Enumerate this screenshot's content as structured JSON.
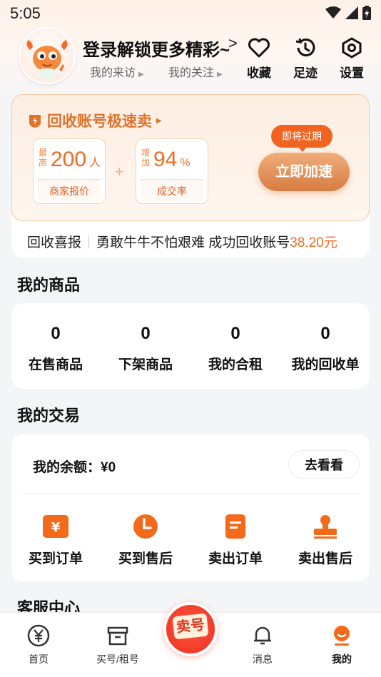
{
  "status_bar": {
    "time": "5:05"
  },
  "header": {
    "login_title": "登录解锁更多精彩~",
    "login_arrow": ">",
    "visitors": "我的来访",
    "following": "我的关注",
    "favorites": "收藏",
    "history": "足迹",
    "settings": "设置"
  },
  "recycle": {
    "title": "回收账号极速卖",
    "stat1": {
      "prefix": "最高",
      "value": "200",
      "unit": "人",
      "label": "商家报价"
    },
    "plus": "+",
    "stat2": {
      "prefix": "增加",
      "value": "94",
      "unit": "%",
      "label": "成交率"
    },
    "expire_badge": "即将过期",
    "speed_button": "立即加速",
    "ticker_label": "回收喜报",
    "ticker_text": "勇敢牛牛不怕艰难 成功回收账号",
    "ticker_amount": "38.20元"
  },
  "goods": {
    "title": "我的商品",
    "items": [
      {
        "count": "0",
        "label": "在售商品"
      },
      {
        "count": "0",
        "label": "下架商品"
      },
      {
        "count": "0",
        "label": "我的合租"
      },
      {
        "count": "0",
        "label": "我的回收单"
      }
    ]
  },
  "trade": {
    "title": "我的交易",
    "balance": "我的余额：¥0",
    "look_button": "去看看",
    "items": [
      {
        "label": "买到订单",
        "icon": "yen-order-icon"
      },
      {
        "label": "买到售后",
        "icon": "clock-icon"
      },
      {
        "label": "卖出订单",
        "icon": "document-icon"
      },
      {
        "label": "卖出售后",
        "icon": "stamp-icon"
      }
    ]
  },
  "service": {
    "title": "客服中心"
  },
  "bottom_nav": {
    "items": [
      {
        "label": "首页",
        "icon": "yen-circle-icon"
      },
      {
        "label": "买号/租号",
        "icon": "box-icon"
      },
      {
        "label": "卖号",
        "icon": "sell-icon"
      },
      {
        "label": "消息",
        "icon": "bell-icon"
      },
      {
        "label": "我的",
        "icon": "profile-icon"
      }
    ]
  },
  "colors": {
    "accent": "#f06a20",
    "brand_red": "#f23a2a",
    "orange_soft": "#e0722a"
  }
}
